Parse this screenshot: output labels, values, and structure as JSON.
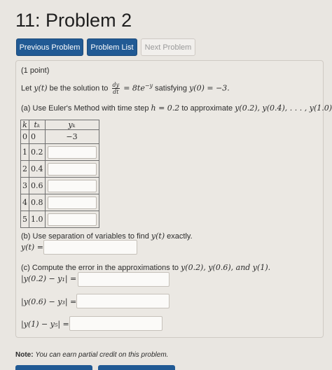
{
  "header": {
    "title": "11: Problem 2"
  },
  "nav": {
    "previous": "Previous Problem",
    "list": "Problem List",
    "next": "Next Problem"
  },
  "problem": {
    "points": "(1 point)",
    "statement": {
      "lead": "Let",
      "y_t": "y(t)",
      "mid": "be the solution to",
      "dy": "dy",
      "dt": "dt",
      "rhs_base": "= 8te",
      "rhs_exp": "−y",
      "sat": "satisfying",
      "init": "y(0) = −3."
    },
    "part_a": {
      "lead": "(a) Use Euler's Method with time step",
      "step": "h = 0.2",
      "mid": "to approximate",
      "targets": "y(0.2), y(0.4), . . . , y(1.0)."
    },
    "table": {
      "headers": [
        "k",
        "tₖ",
        "yₖ"
      ],
      "first_row": {
        "k": "0",
        "t": "0",
        "y": "−3"
      },
      "rows": [
        {
          "k": "1",
          "t": "0.2"
        },
        {
          "k": "2",
          "t": "0.4"
        },
        {
          "k": "3",
          "t": "0.6"
        },
        {
          "k": "4",
          "t": "0.8"
        },
        {
          "k": "5",
          "t": "1.0"
        }
      ]
    },
    "part_b": {
      "lead": "(b) Use separation of variables to find",
      "y_t": "y(t)",
      "tail": "exactly.",
      "label": "y(t) ="
    },
    "part_c": {
      "lead": "(c) Compute the error in the approximations to",
      "targets": "y(0.2), y(0.6), and y(1).",
      "err1": "|y(0.2) − y₁| =",
      "err2": "|y(0.6) − y₃| =",
      "err3": "|y(1) − y₅| ="
    },
    "note": {
      "label": "Note:",
      "text": "You can earn partial credit on this problem."
    }
  },
  "colors": {
    "primary": "#215a94",
    "page": "#e9e6e1",
    "input": "#fbfaf8"
  }
}
